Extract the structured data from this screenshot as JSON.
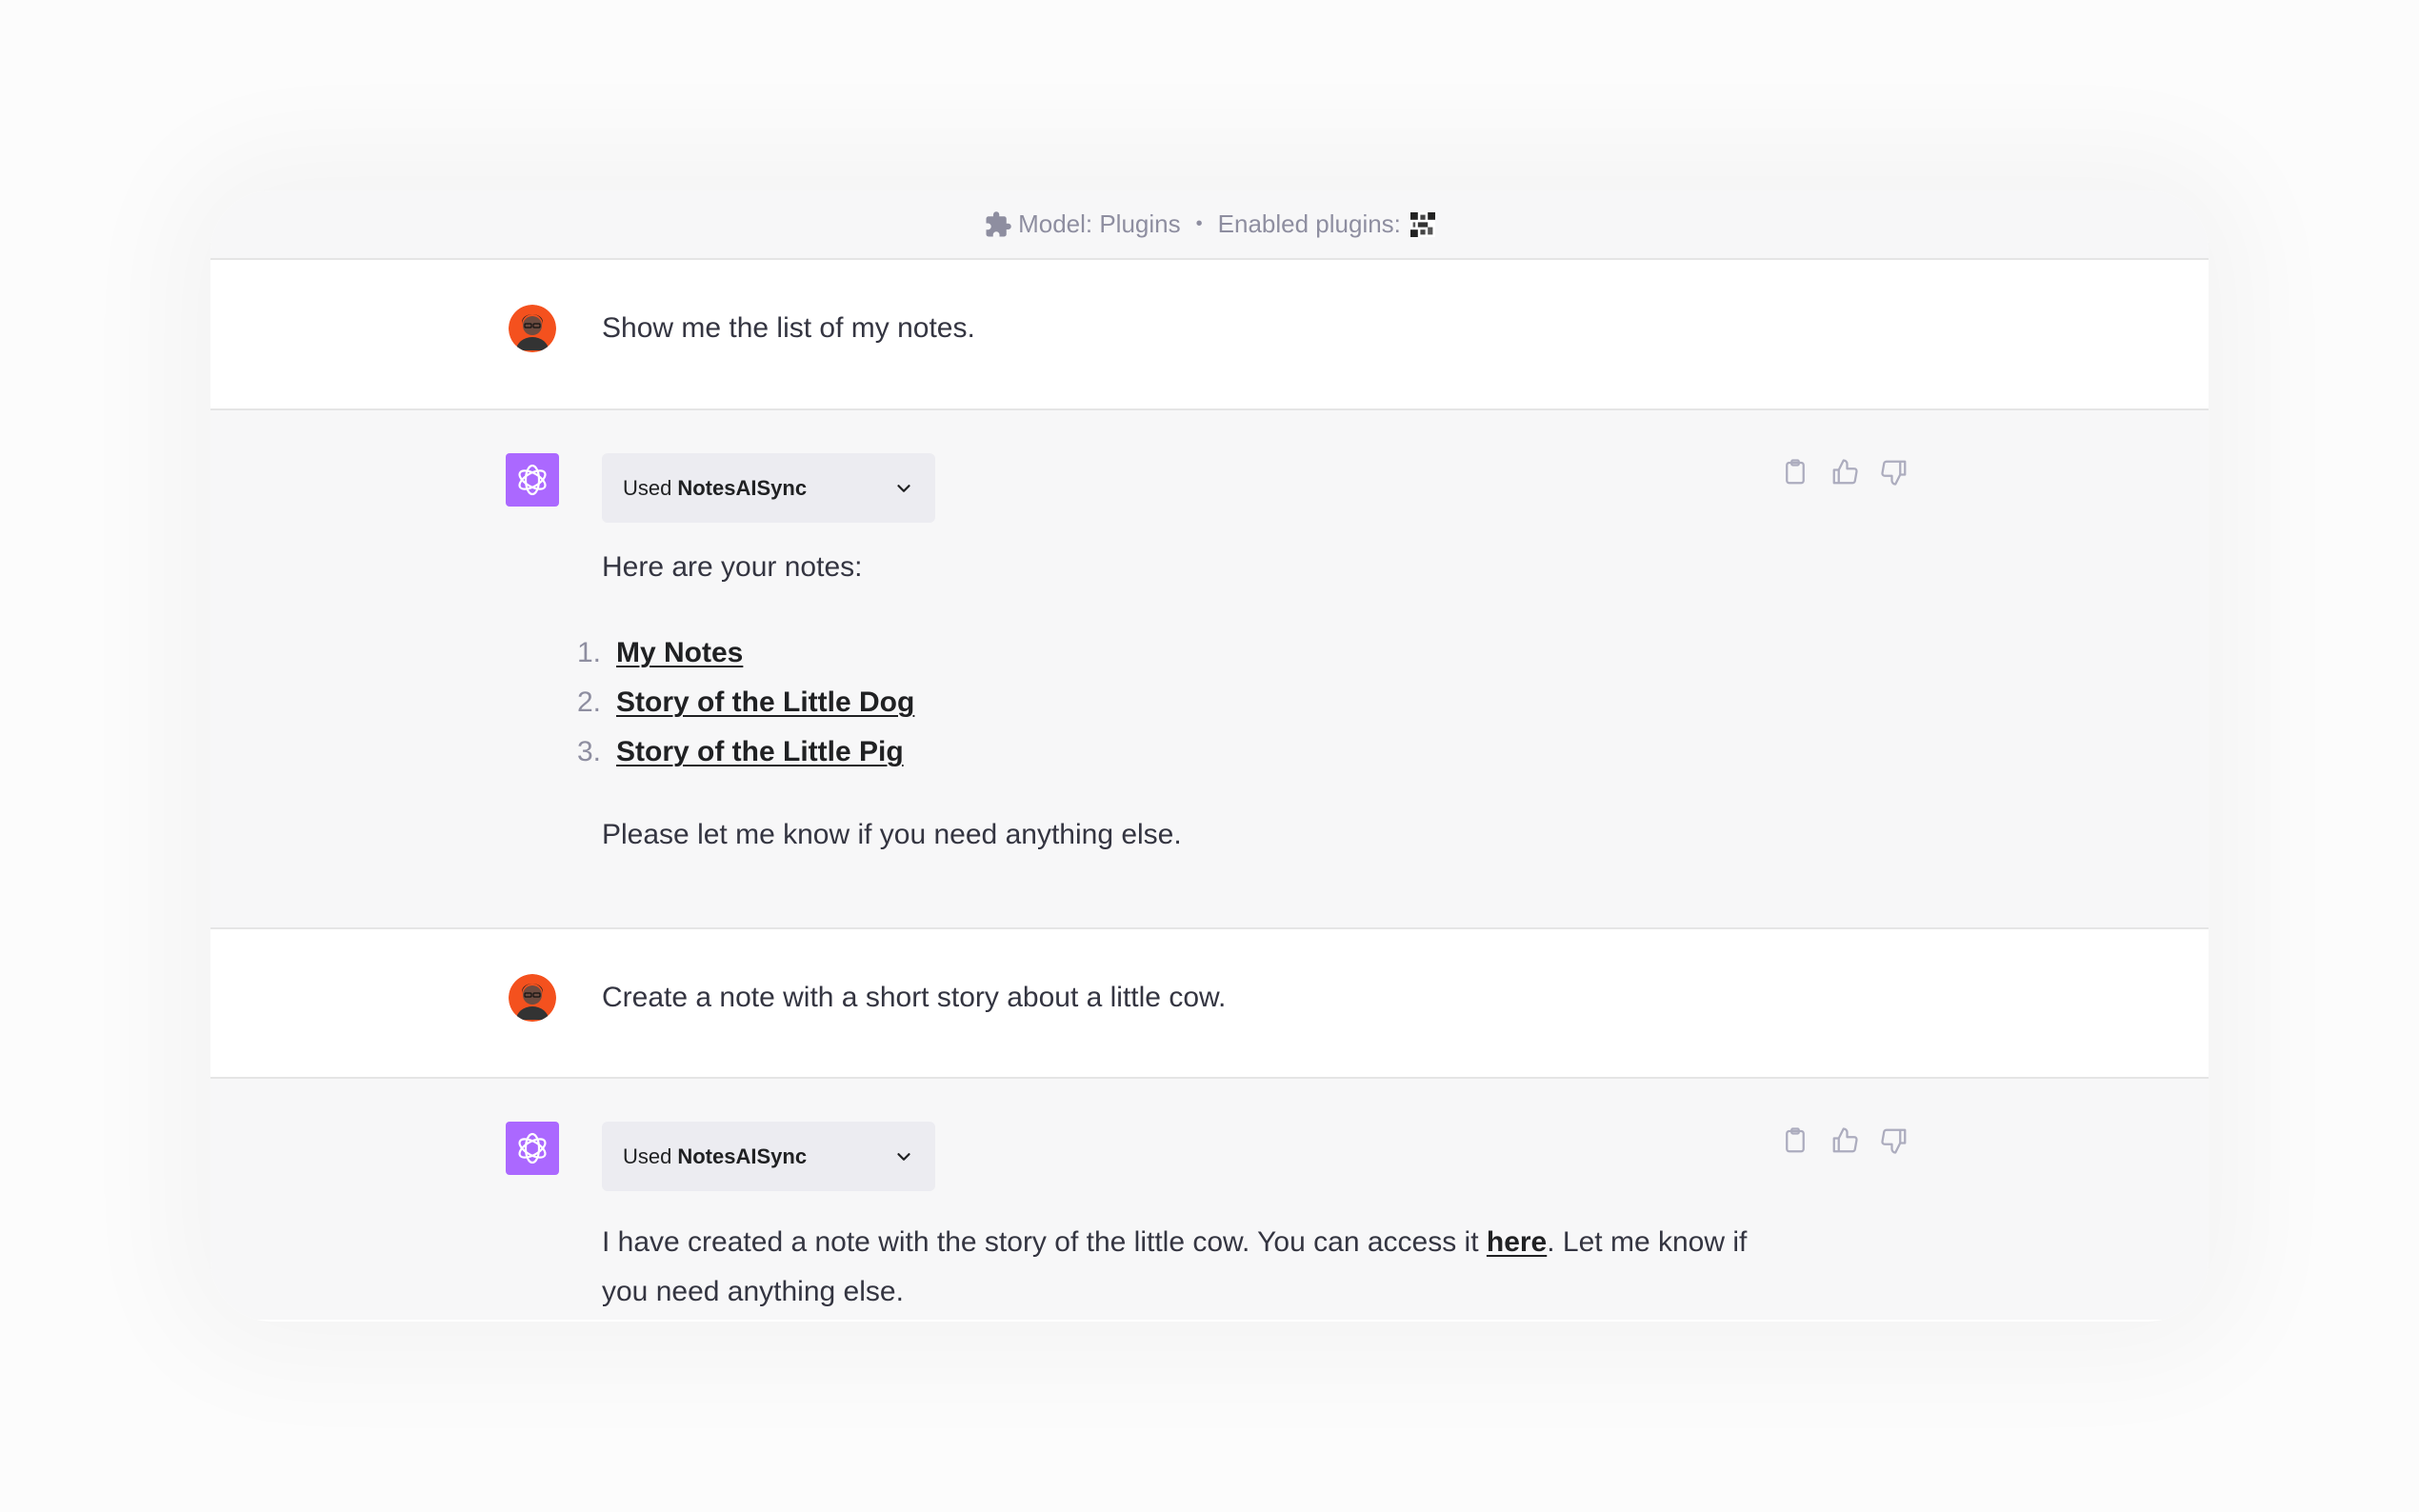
{
  "header": {
    "model_label": "Model: Plugins",
    "separator": "•",
    "plugins_label": "Enabled plugins:",
    "plugin_icon": "notesaisync-logo-icon"
  },
  "messages": [
    {
      "role": "user",
      "text": "Show me the list of my notes."
    },
    {
      "role": "assistant",
      "used_prefix": "Used",
      "used_plugin": "NotesAISync",
      "intro": "Here are your notes:",
      "notes": [
        {
          "number": "1.",
          "title": "My Notes"
        },
        {
          "number": "2.",
          "title": "Story of the Little Dog"
        },
        {
          "number": "3.",
          "title": "Story of the Little Pig"
        }
      ],
      "outro": "Please let me know if you need anything else."
    },
    {
      "role": "user",
      "text": "Create a note with a short story about a little cow."
    },
    {
      "role": "assistant",
      "used_prefix": "Used",
      "used_plugin": "NotesAISync",
      "line1_before": "I have created a note with the story of the little cow. You can access it ",
      "link_text": "here",
      "line1_after": ". Let me know if",
      "line2": "you need anything else."
    }
  ],
  "colors": {
    "gpt_avatar": "#ab68ff",
    "user_avatar": "#f4511e",
    "assistant_bg": "#f7f7f8",
    "text": "#343541",
    "muted": "#8e8ea0"
  }
}
